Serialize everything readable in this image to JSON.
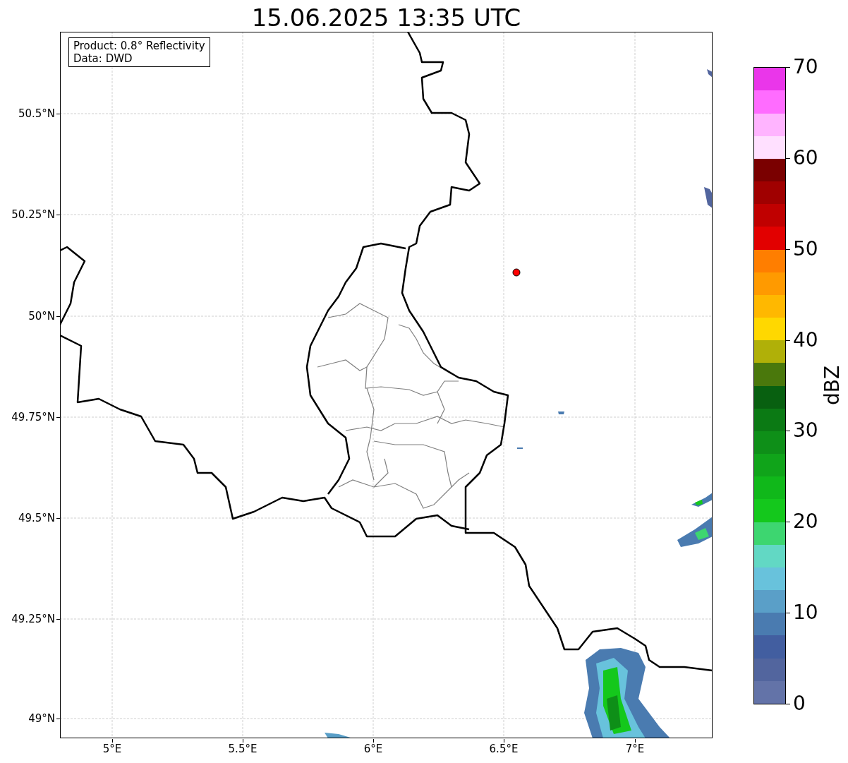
{
  "title": "15.06.2025 13:35 UTC",
  "info_box": [
    "Product: 0.8° Reflectivity",
    "Data: DWD"
  ],
  "lat_ticks": [
    "50.5°N",
    "50.25°N",
    "50°N",
    "49.75°N",
    "49.5°N",
    "49.25°N",
    "49°N"
  ],
  "lon_ticks": [
    "5°E",
    "5.5°E",
    "6°E",
    "6.5°E",
    "7°E"
  ],
  "colorbar": {
    "label": "dBZ",
    "ticks": [
      "70",
      "60",
      "50",
      "40",
      "30",
      "20",
      "10",
      "0"
    ],
    "segments": [
      {
        "color": "#6373a8"
      },
      {
        "color": "#52659e"
      },
      {
        "color": "#425ea0"
      },
      {
        "color": "#4a7bb0"
      },
      {
        "color": "#5a9fc8"
      },
      {
        "color": "#68c2dc"
      },
      {
        "color": "#62d8c4"
      },
      {
        "color": "#3dd670"
      },
      {
        "color": "#14c81c"
      },
      {
        "color": "#10b81a"
      },
      {
        "color": "#10a41a"
      },
      {
        "color": "#0e8f18"
      },
      {
        "color": "#0b7a14"
      },
      {
        "color": "#086010"
      },
      {
        "color": "#4a780c"
      },
      {
        "color": "#b0b008"
      },
      {
        "color": "#ffd800"
      },
      {
        "color": "#ffb800"
      },
      {
        "color": "#ff9a00"
      },
      {
        "color": "#ff7e00"
      },
      {
        "color": "#e20000"
      },
      {
        "color": "#c00000"
      },
      {
        "color": "#a00000"
      },
      {
        "color": "#7a0000"
      },
      {
        "color": "#ffe0ff"
      },
      {
        "color": "#ffb4ff"
      },
      {
        "color": "#ff6cff"
      },
      {
        "color": "#ea36ea"
      }
    ]
  }
}
